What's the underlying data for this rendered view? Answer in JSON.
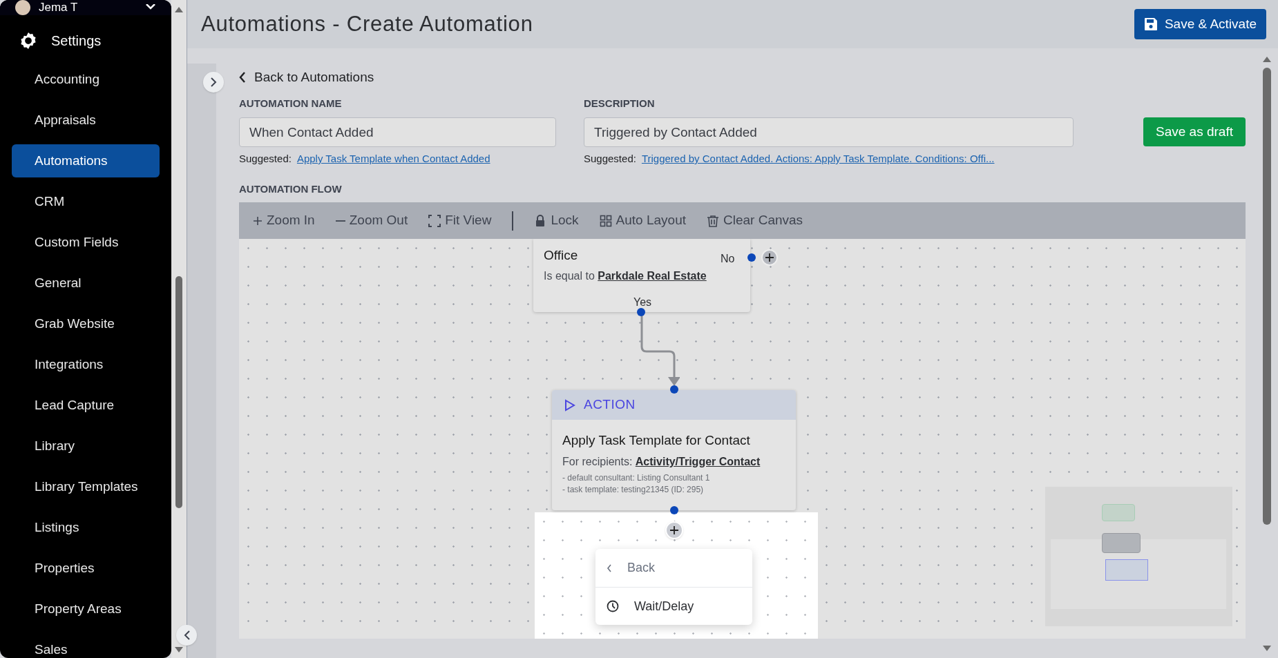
{
  "sidebar": {
    "user": {
      "name": "Jema T"
    },
    "section": {
      "label": "Settings"
    },
    "items": [
      {
        "label": "Accounting",
        "selected": false
      },
      {
        "label": "Appraisals",
        "selected": false
      },
      {
        "label": "Automations",
        "selected": true
      },
      {
        "label": "CRM",
        "selected": false
      },
      {
        "label": "Custom Fields",
        "selected": false
      },
      {
        "label": "General",
        "selected": false
      },
      {
        "label": "Grab Website",
        "selected": false
      },
      {
        "label": "Integrations",
        "selected": false
      },
      {
        "label": "Lead Capture",
        "selected": false
      },
      {
        "label": "Library",
        "selected": false
      },
      {
        "label": "Library Templates",
        "selected": false
      },
      {
        "label": "Listings",
        "selected": false
      },
      {
        "label": "Properties",
        "selected": false
      },
      {
        "label": "Property Areas",
        "selected": false
      },
      {
        "label": "Sales",
        "selected": false
      }
    ]
  },
  "header": {
    "title": "Automations - Create Automation",
    "primary_button": "Save & Activate"
  },
  "back_link": "Back to Automations",
  "form": {
    "name": {
      "label": "AUTOMATION NAME",
      "value": "When Contact Added",
      "suggested_label": "Suggested:",
      "suggestion": "Apply Task Template when Contact Added"
    },
    "description": {
      "label": "DESCRIPTION",
      "value": "Triggered by Contact Added",
      "suggested_label": "Suggested:",
      "suggestion": "Triggered by Contact Added. Actions: Apply Task Template. Conditions: Offi..."
    },
    "draft_button": "Save as draft"
  },
  "flow": {
    "label": "AUTOMATION FLOW",
    "toolbar": [
      {
        "kind": "plus",
        "label": "Zoom In"
      },
      {
        "kind": "minus",
        "label": "Zoom Out"
      },
      {
        "kind": "fit",
        "label": "Fit View"
      },
      {
        "kind": "divider"
      },
      {
        "kind": "lock",
        "label": "Lock"
      },
      {
        "kind": "grid",
        "label": "Auto Layout"
      },
      {
        "kind": "trash",
        "label": "Clear Canvas"
      }
    ],
    "condition": {
      "field": "Office",
      "operator": "Is equal to",
      "value": "Parkdale Real Estate",
      "no_label": "No",
      "yes_label": "Yes"
    },
    "action": {
      "header": "ACTION",
      "title": "Apply Task Template for Contact",
      "recipients_label": "For recipients:",
      "recipients": "Activity/Trigger Contact",
      "details": [
        "- default consultant: Listing Consultant 1",
        "- task template: testing21345 (ID: 295)"
      ]
    },
    "menu": [
      {
        "kind": "back",
        "label": "Back"
      },
      {
        "kind": "clock",
        "label": "Wait/Delay"
      }
    ]
  }
}
